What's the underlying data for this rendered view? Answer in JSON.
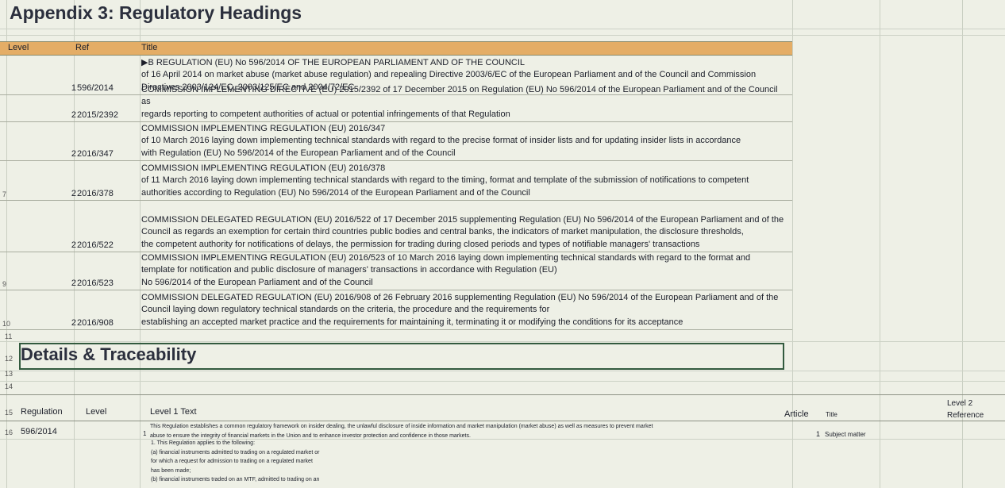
{
  "appendix_title": "Appendix 3: Regulatory Headings",
  "table1": {
    "headers": {
      "level": "Level",
      "ref": "Ref",
      "title": "Title"
    },
    "rows": [
      {
        "level": "1",
        "ref": "596/2014",
        "title": "▶B REGULATION (EU) No 596/2014 OF THE EUROPEAN PARLIAMENT AND OF THE COUNCIL\nof 16 April 2014 on market abuse (market abuse regulation) and repealing Directive 2003/6/EC of the European Parliament and of the Council and Commission\nDirectives 2003/124/EC, 2003/125/EC and 2004/72/EC"
      },
      {
        "level": "2",
        "ref": "2015/2392",
        "title": "COMMISSION IMPLEMENTING DIRECTIVE (EU) 2015/2392 of 17 December 2015 on Regulation (EU) No 596/2014 of the European Parliament and of the Council as\nregards reporting to competent authorities of actual or potential infringements of that Regulation"
      },
      {
        "level": "2",
        "ref": "2016/347",
        "title": "COMMISSION IMPLEMENTING REGULATION (EU) 2016/347\nof 10 March 2016 laying down implementing technical standards with regard to the precise format of insider lists and for updating insider lists in accordance\nwith Regulation (EU) No 596/2014 of the European Parliament and of the Council"
      },
      {
        "level": "2",
        "ref": "2016/378",
        "title": "COMMISSION IMPLEMENTING REGULATION (EU) 2016/378\nof 11 March 2016 laying down implementing technical standards with regard to the timing, format and template of the submission of notifications to competent\nauthorities according to Regulation (EU) No 596/2014 of the European Parliament and of the Council"
      },
      {
        "level": "2",
        "ref": "2016/522",
        "title": "COMMISSION DELEGATED REGULATION (EU) 2016/522 of 17 December 2015 supplementing Regulation (EU) No 596/2014 of the European Parliament and of the\nCouncil as regards an exemption for certain third countries public bodies and central banks, the indicators of market manipulation, the disclosure thresholds,\nthe competent authority for notifications of delays, the permission for trading during closed periods and types of notifiable managers' transactions"
      },
      {
        "level": "2",
        "ref": "2016/523",
        "title": "COMMISSION IMPLEMENTING REGULATION (EU) 2016/523 of 10 March 2016 laying down implementing technical standards with regard to the format and\ntemplate for notification and public disclosure of managers' transactions in accordance with Regulation (EU)\nNo 596/2014 of the European Parliament and of the Council"
      },
      {
        "level": "2",
        "ref": "2016/908",
        "title": "COMMISSION DELEGATED REGULATION (EU) 2016/908 of 26 February 2016 supplementing Regulation (EU) No 596/2014 of the European Parliament and of the\nCouncil laying down regulatory technical standards on the criteria, the procedure and the requirements for\nestablishing an accepted market practice and the requirements for maintaining it, terminating it or modifying the conditions for its acceptance"
      }
    ]
  },
  "row_numbers": {
    "r7": "7",
    "r9": "9",
    "r10": "10",
    "r11": "11",
    "r12": "12",
    "r13": "13",
    "r14": "14",
    "r15": "15",
    "r16": "16"
  },
  "section2_title": "Details & Traceability",
  "table2": {
    "headers": {
      "regulation": "Regulation",
      "level": "Level",
      "level1_text": "Level 1 Text",
      "article": "Article",
      "title": "Title",
      "level2_ref": "Level 2\nReference"
    },
    "row1": {
      "regulation": "596/2014",
      "level": "1",
      "text": "This Regulation establishes a common regulatory framework on insider dealing, the unlawful disclosure of inside information and market manipulation (market abuse) as well as measures to prevent market\nabuse to ensure the integrity of financial markets in the Union and to enhance investor protection and confidence in those markets.",
      "article": "1",
      "title": "Subject matter"
    },
    "row2_text": "1. This Regulation applies to the following:\n(a) financial instruments admitted to trading on a regulated market or\nfor which a request for admission to trading on a regulated market\nhas been made;\n(b) financial instruments traded on an MTF, admitted to trading on an"
  },
  "colors": {
    "header_fill": "#e4ad66",
    "background": "#eef0e6",
    "section_border": "#325a3e"
  }
}
